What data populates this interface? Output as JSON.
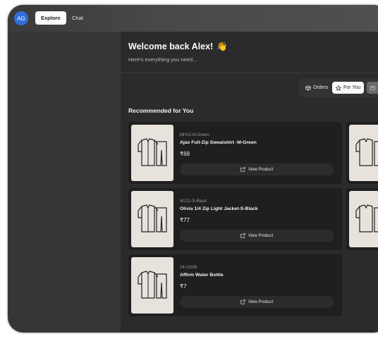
{
  "header": {
    "avatar_initials": "AG",
    "nav": [
      {
        "label": "Explore"
      },
      {
        "label": "Chat"
      }
    ]
  },
  "main": {
    "welcome_title": "Welcome back Alex!",
    "welcome_emoji": "👋",
    "subtitle": "Here's everything you need...",
    "tabs": [
      {
        "label": "Orders",
        "icon": "box-icon"
      },
      {
        "label": "For You",
        "icon": "star-icon"
      }
    ],
    "section_title": "Recommended for You",
    "view_label": "View Product",
    "products": [
      {
        "sku": "MH12-M-Green",
        "name": "Ajax Full-Zip Sweatshirt -M-Green",
        "price": "₹69"
      },
      {
        "sku": "WJ12-S-Black",
        "name": "Olivia 1/4 Zip Light Jacket-S-Black",
        "price": "₹77"
      },
      {
        "sku": "24-UG06",
        "name": "Affirm Water Bottle",
        "price": "₹7"
      }
    ]
  },
  "colors": {
    "accent": "#2f6fdc",
    "card_bg": "#1f1f1f",
    "image_bg": "#e7e3dc"
  }
}
